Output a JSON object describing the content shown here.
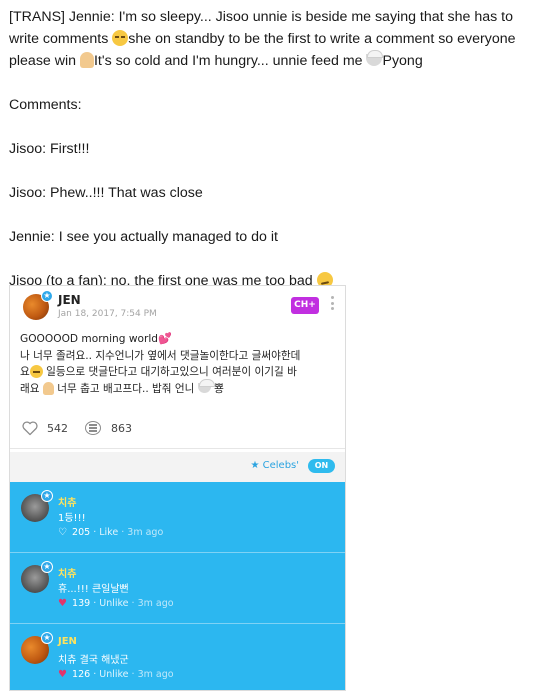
{
  "post": {
    "line1_a": "[TRANS] Jennie: I'm so sleepy... Jisoo unnie is beside me saying that she has to write comments ",
    "line1_b": "she on standby to be the first to write a comment so everyone please win ",
    "line1_c": "It's so cold and I'm hungry... unnie feed me ",
    "line1_d": "Pyong",
    "comments_heading": "Comments:",
    "c1": "Jisoo: First!!!",
    "c2": "Jisoo: Phew..!!! That was close",
    "c3": "Jennie: I see you actually managed to do it",
    "c4": "Jisoo (to a fan): no, the first one was me too bad "
  },
  "icons": {
    "sleepy": "sleepy-face-emoji",
    "pray": "folded-hands-emoji",
    "rice": "rice-bowl-emoji",
    "smirk": "smirk-face-emoji"
  },
  "screenshot": {
    "author": "JEN",
    "date": "Jan 18, 2017, 7:54 PM",
    "channel_badge": "CH+",
    "text_1": "GOOOOOD morning world",
    "text_2": "나 너무 졸려요.. 지수언니가 옆에서 댓글놀이한다고 글써야한데",
    "text_3a": "요",
    "text_3b": " 일등으로 댓글단다고 대기하고있으니 여러분이 이기길 바",
    "text_4a": "래요 ",
    "text_4b": " 너무 춥고 배고프다.. 밥줘 언니 ",
    "text_4c": " 뿅",
    "likes": "542",
    "comment_count": "863",
    "celebs_label": "Celebs'",
    "toggle_label": "ON",
    "comments": [
      {
        "name": "치츄",
        "text": "1등!!!",
        "likes": "205",
        "action": "Like",
        "time": "3m ago"
      },
      {
        "name": "치츄",
        "text": "휴...!!! 큰일날뻔",
        "likes": "139",
        "action": "Unlike",
        "time": "3m ago"
      },
      {
        "name": "JEN",
        "text": "치츄 결국 해냈군",
        "likes": "126",
        "action": "Unlike",
        "time": "3m ago"
      }
    ]
  },
  "colors": {
    "comment_bg": "#2cb7f0",
    "name_yellow": "#ffe35c",
    "ch_badge": "#c12fe0",
    "heart_pink": "#e2356b",
    "accent_blue": "#2aa3e0"
  }
}
